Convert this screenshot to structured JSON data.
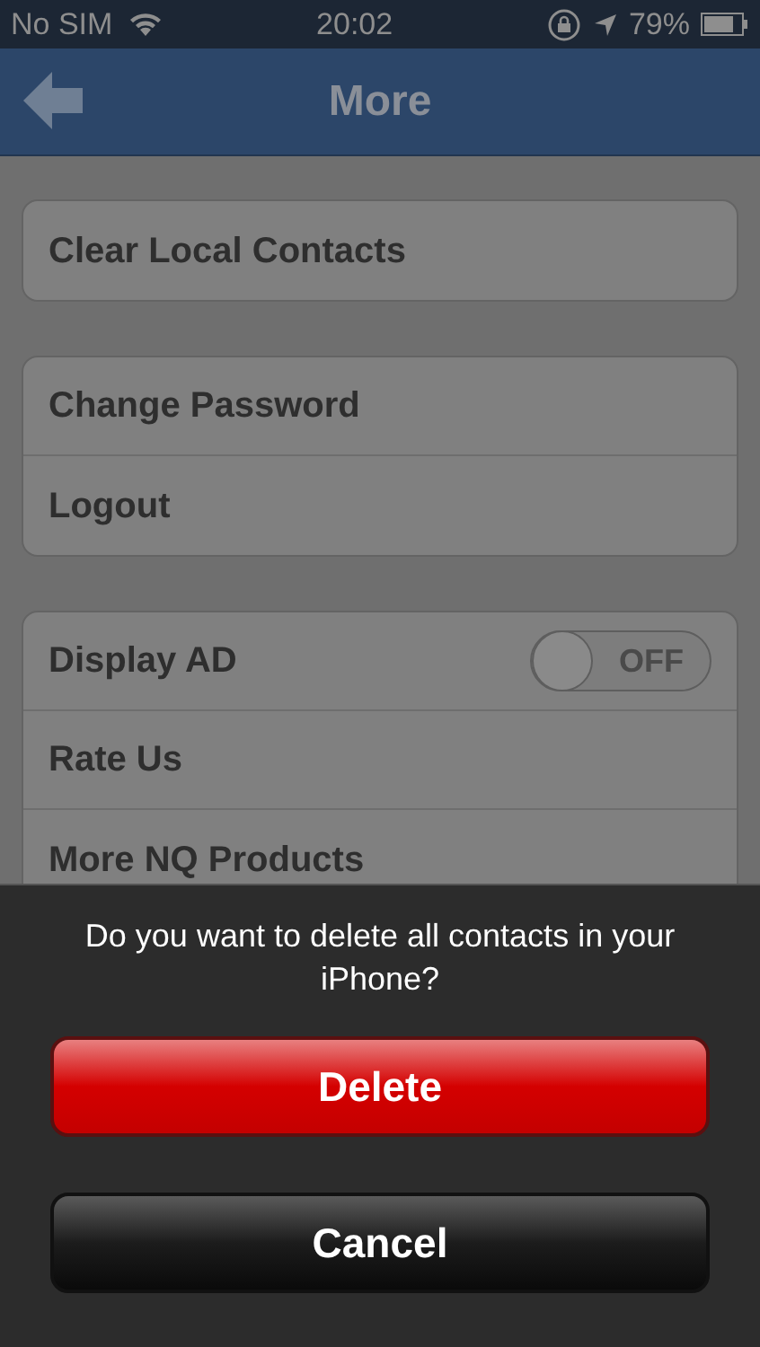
{
  "status_bar": {
    "carrier": "No SIM",
    "time": "20:02",
    "battery": "79%"
  },
  "nav": {
    "title": "More"
  },
  "groups": [
    {
      "rows": [
        {
          "kind": "link",
          "label": "Clear Local Contacts"
        }
      ]
    },
    {
      "rows": [
        {
          "kind": "link",
          "label": "Change Password"
        },
        {
          "kind": "link",
          "label": "Logout"
        }
      ]
    },
    {
      "rows": [
        {
          "kind": "toggle",
          "label": "Display AD",
          "on": false,
          "state_label": "OFF"
        },
        {
          "kind": "link",
          "label": "Rate Us"
        },
        {
          "kind": "link",
          "label": "More NQ Products"
        }
      ]
    }
  ],
  "action_sheet": {
    "message": "Do you want to delete all contacts in your iPhone?",
    "buttons": [
      {
        "kind": "destructive",
        "label": "Delete"
      },
      {
        "kind": "cancel",
        "label": "Cancel"
      }
    ]
  }
}
